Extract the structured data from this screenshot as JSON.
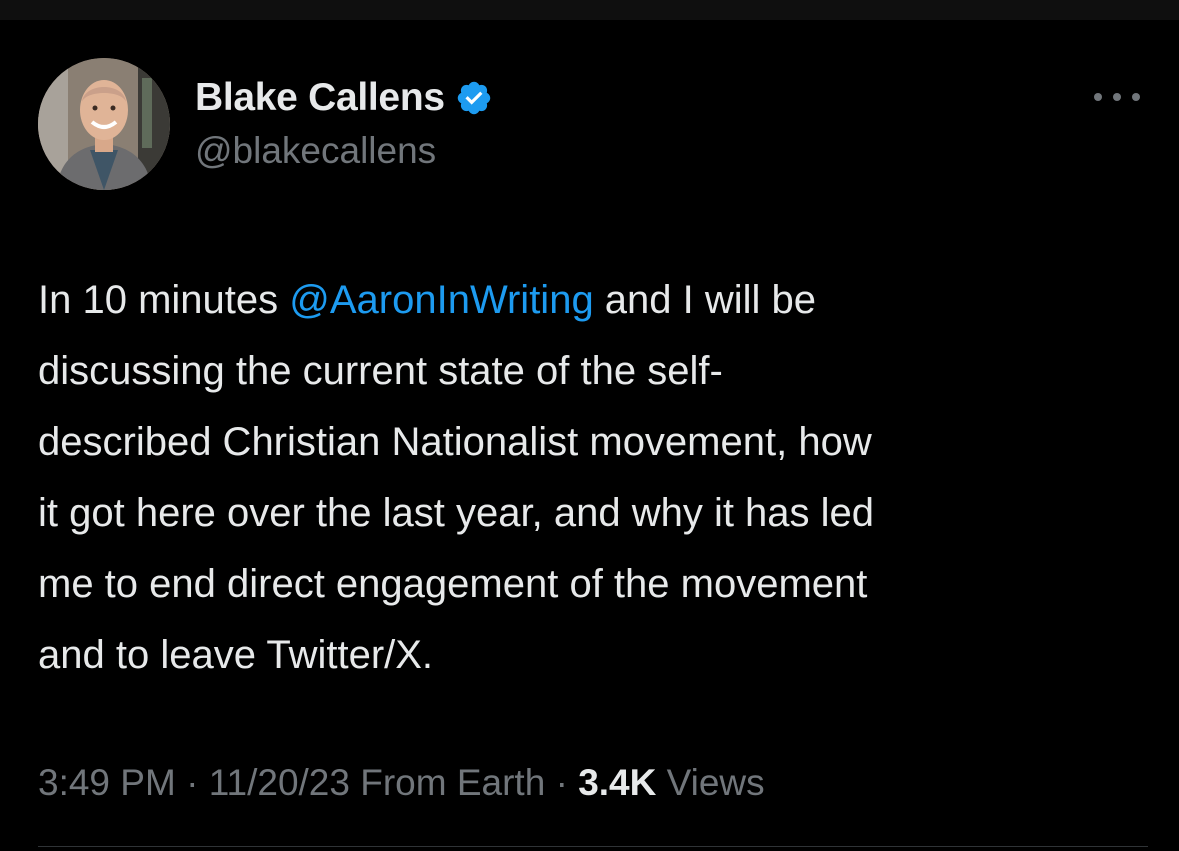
{
  "colors": {
    "background": "#000000",
    "text_primary": "#e7e9ea",
    "text_secondary": "#71767b",
    "accent": "#1d9bf0"
  },
  "author": {
    "display_name": "Blake Callens",
    "handle": "@blakecallens",
    "avatar_icon": "profile-photo",
    "verified_icon": "verified-badge-icon"
  },
  "more_icon": "more-options-icon",
  "tweet": {
    "lines": [
      {
        "before": "In 10 minutes ",
        "mention": "@AaronInWriting",
        "after": " and I will be"
      },
      {
        "text": "discussing the current state of the self-"
      },
      {
        "text": "described Christian Nationalist movement, how"
      },
      {
        "text": "it got here over the last year, and why it has led"
      },
      {
        "text": "me to end direct engagement of the movement"
      },
      {
        "text": "and to leave Twitter/X."
      }
    ]
  },
  "meta": {
    "time": "3:49 PM",
    "separator": " · ",
    "date": "11/20/23",
    "source": " From Earth",
    "views_count": "3.4K",
    "views_label": " Views"
  }
}
